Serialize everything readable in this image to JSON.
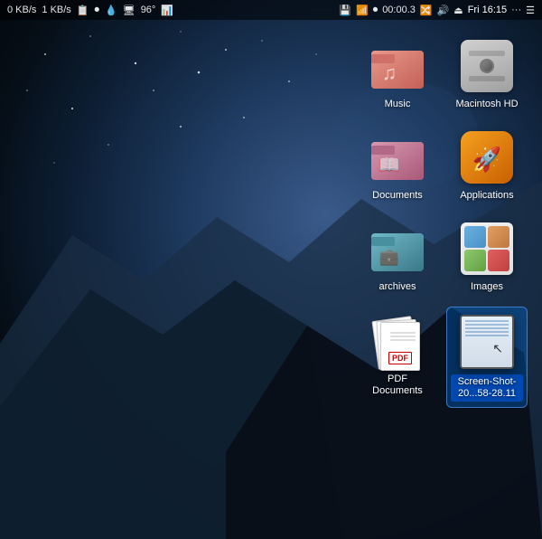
{
  "menubar": {
    "left": {
      "network_up": "0 KB/s",
      "network_down": "1 KB/s"
    },
    "icons": [
      "📋",
      "🔴",
      "💧",
      "🖥",
      "96°",
      "📊",
      "💾",
      "📶",
      "⏺",
      "00:00.3",
      "🔀",
      "📶",
      "🔊",
      "⏏",
      "Fri 16:15",
      "···",
      "☰"
    ],
    "time": "Fri 16:15"
  },
  "desktop_icons": [
    {
      "id": "music",
      "label": "Music",
      "type": "folder-music"
    },
    {
      "id": "macintosh-hd",
      "label": "Macintosh HD",
      "type": "hd"
    },
    {
      "id": "documents",
      "label": "Documents",
      "type": "folder-docs"
    },
    {
      "id": "applications",
      "label": "Applications",
      "type": "apps"
    },
    {
      "id": "archives",
      "label": "archives",
      "type": "folder-archives"
    },
    {
      "id": "images",
      "label": "Images",
      "type": "images"
    },
    {
      "id": "pdf-documents",
      "label": "PDF Documents",
      "type": "pdf"
    },
    {
      "id": "screenshot",
      "label": "Screen-Shot-20...58-28.11",
      "type": "screenshot"
    }
  ]
}
